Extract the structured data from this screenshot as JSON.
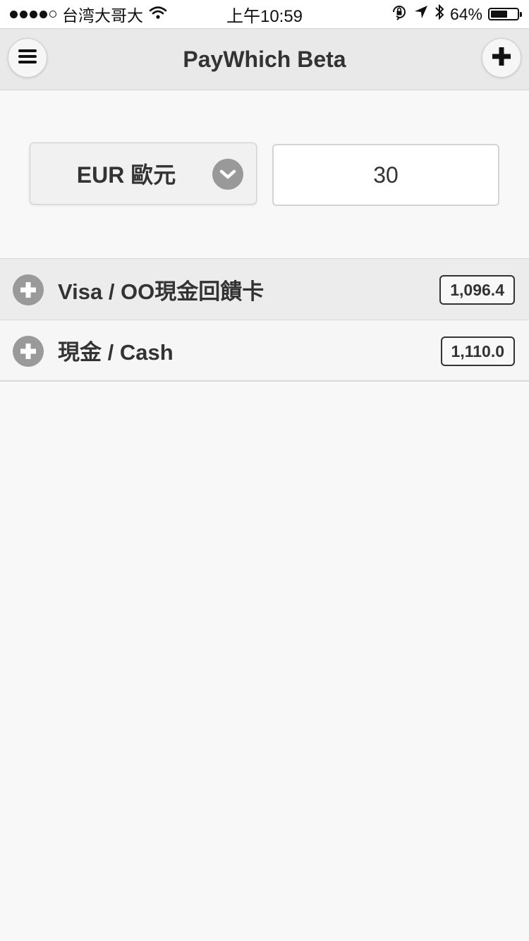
{
  "status_bar": {
    "carrier": "台湾大哥大",
    "time": "上午10:59",
    "battery_percent": "64%",
    "battery_level": 0.64,
    "icons": [
      "signal-dots-icon",
      "wifi-icon",
      "rotation-lock-icon",
      "location-arrow-icon",
      "bluetooth-icon",
      "battery-icon"
    ]
  },
  "header": {
    "title": "PayWhich Beta",
    "menu_icon": "hamburger-menu-icon",
    "add_icon": "plus-icon"
  },
  "converter": {
    "currency_selected": "EUR 歐元",
    "dropdown_icon": "chevron-down-icon",
    "amount_value": "30"
  },
  "list": {
    "items": [
      {
        "label": "Visa / OO現金回饋卡",
        "amount": "1,096.4",
        "icon": "plus-circle-icon"
      },
      {
        "label": "現金 / Cash",
        "amount": "1,110.0",
        "icon": "plus-circle-icon"
      }
    ]
  },
  "colors": {
    "header_bg": "#e9e9e9",
    "page_bg": "#f8f8f8",
    "icon_gray": "#9a9a9a",
    "text_dark": "#333333"
  }
}
